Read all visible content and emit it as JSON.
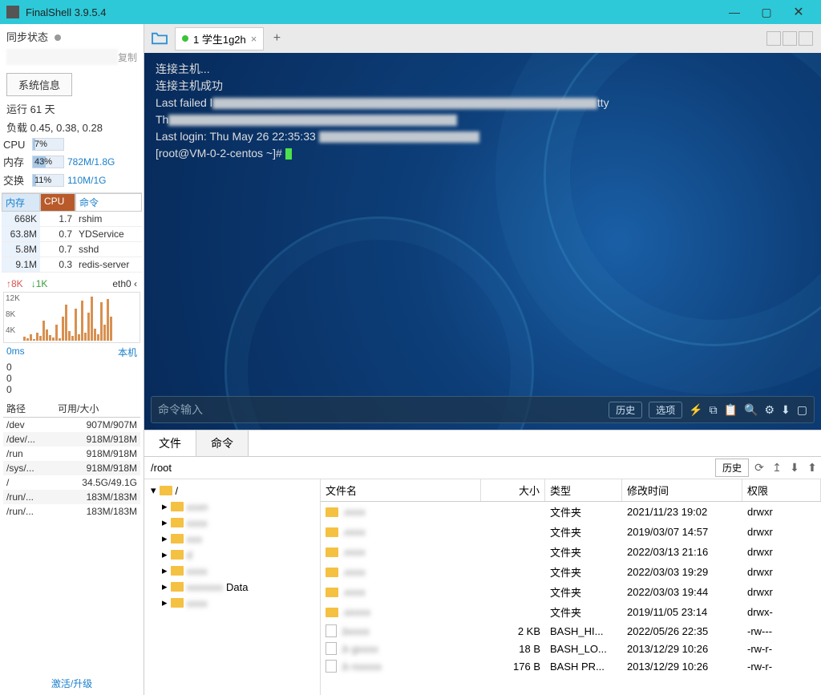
{
  "window": {
    "title": "FinalShell 3.9.5.4"
  },
  "sidebar": {
    "sync_label": "同步状态",
    "copy": "复制",
    "sysinfo_btn": "系统信息",
    "uptime": "运行 61 天",
    "load": "负载 0.45, 0.38, 0.28",
    "cpu": {
      "label": "CPU",
      "pct": "7%"
    },
    "mem": {
      "label": "内存",
      "pct": "43%",
      "vals": "782M/1.8G"
    },
    "swap": {
      "label": "交换",
      "pct": "11%",
      "vals": "110M/1G"
    },
    "proc_hdr": {
      "mem": "内存",
      "cpu": "CPU",
      "cmd": "命令"
    },
    "procs": [
      {
        "mem": "668K",
        "cpu": "1.7",
        "cmd": "rshim"
      },
      {
        "mem": "63.8M",
        "cpu": "0.7",
        "cmd": "YDService"
      },
      {
        "mem": "5.8M",
        "cpu": "0.7",
        "cmd": "sshd"
      },
      {
        "mem": "9.1M",
        "cpu": "0.3",
        "cmd": "redis-server"
      }
    ],
    "net": {
      "up": "↑8K",
      "down": "↓1K",
      "iface": "eth0 ‹"
    },
    "chart_y": [
      "12K",
      "8K",
      "4K"
    ],
    "ping": {
      "ms": "0ms",
      "loc": "本机"
    },
    "ping_vals": [
      "0",
      "0",
      "0"
    ],
    "disk_hdr": {
      "path": "路径",
      "size": "可用/大小"
    },
    "disks": [
      {
        "p": "/dev",
        "s": "907M/907M"
      },
      {
        "p": "/dev/...",
        "s": "918M/918M"
      },
      {
        "p": "/run",
        "s": "918M/918M"
      },
      {
        "p": "/sys/...",
        "s": "918M/918M"
      },
      {
        "p": "/",
        "s": "34.5G/49.1G"
      },
      {
        "p": "/run/...",
        "s": "183M/183M"
      },
      {
        "p": "/run/...",
        "s": "183M/183M"
      }
    ],
    "activate": "激活/升级"
  },
  "tabs": {
    "title": "1 学生1g2h"
  },
  "terminal": {
    "l1": "连接主机...",
    "l2": "连接主机成功",
    "l3a": "Last failed l",
    "l3b": "tty",
    "l4a": "Th",
    "l5": "Last login: Thu May 26 22:35:33",
    "l6": "[root@VM-0-2-centos ~]# "
  },
  "cmdbar": {
    "placeholder": "命令输入",
    "history": "历史",
    "options": "选项"
  },
  "bottom": {
    "tab_files": "文件",
    "tab_cmd": "命令",
    "path": "/root",
    "history": "历史",
    "tree_root": "/",
    "tree_data": "Data",
    "hdr": {
      "name": "文件名",
      "size": "大小",
      "type": "类型",
      "date": "修改时间",
      "perm": "权限"
    },
    "rows": [
      {
        "kind": "folder",
        "name": ".",
        "size": "",
        "type": "文件夹",
        "date": "2021/11/23 19:02",
        "perm": "drwxr"
      },
      {
        "kind": "folder",
        "name": ".",
        "size": "",
        "type": "文件夹",
        "date": "2019/03/07 14:57",
        "perm": "drwxr"
      },
      {
        "kind": "folder",
        "name": ".",
        "size": "",
        "type": "文件夹",
        "date": "2022/03/13 21:16",
        "perm": "drwxr"
      },
      {
        "kind": "folder",
        "name": ".",
        "size": "",
        "type": "文件夹",
        "date": "2022/03/03 19:29",
        "perm": "drwxr"
      },
      {
        "kind": "folder",
        "name": ".",
        "size": "",
        "type": "文件夹",
        "date": "2022/03/03 19:44",
        "perm": "drwxr"
      },
      {
        "kind": "folder",
        "name": ".s",
        "size": "",
        "type": "文件夹",
        "date": "2019/11/05 23:14",
        "perm": "drwx-"
      },
      {
        "kind": "file",
        "name": ".b",
        "size": "2 KB",
        "type": "BASH_HI...",
        "date": "2022/05/26 22:35",
        "perm": "-rw---"
      },
      {
        "kind": "file",
        "name": ".b   g",
        "size": "18 B",
        "type": "BASH_LO...",
        "date": "2013/12/29 10:26",
        "perm": "-rw-r-"
      },
      {
        "kind": "file",
        "name": ".b   ro",
        "size": "176 B",
        "type": "BASH PR...",
        "date": "2013/12/29 10:26",
        "perm": "-rw-r-"
      }
    ]
  }
}
